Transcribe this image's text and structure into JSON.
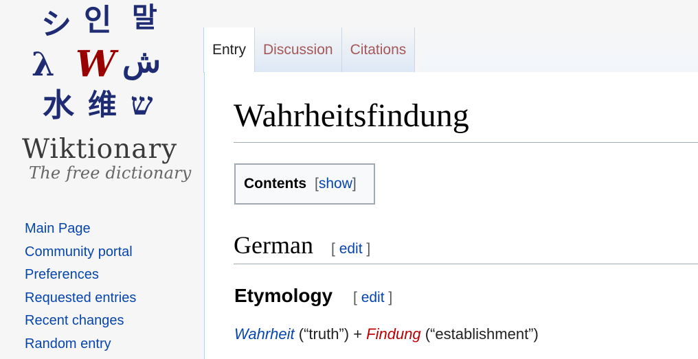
{
  "logo": {
    "glyphs": [
      "シ",
      "인",
      "말",
      "λ",
      "W",
      "ش",
      "水",
      "维",
      "ש"
    ],
    "wordmark": "Wiktionary",
    "tagline": "The free dictionary"
  },
  "sidebar": {
    "items": [
      {
        "label": "Main Page"
      },
      {
        "label": "Community portal"
      },
      {
        "label": "Preferences"
      },
      {
        "label": "Requested entries"
      },
      {
        "label": "Recent changes"
      },
      {
        "label": "Random entry"
      }
    ]
  },
  "tabs": [
    {
      "label": "Entry",
      "selected": true
    },
    {
      "label": "Discussion",
      "selected": false
    },
    {
      "label": "Citations",
      "selected": false
    }
  ],
  "page": {
    "title": "Wahrheitsfindung",
    "toc": {
      "title": "Contents",
      "toggle": "show",
      "open": "[",
      "close": "]"
    },
    "language_heading": "German",
    "etymology_heading": "Etymology",
    "edit": {
      "open": "[",
      "label": "edit",
      "close": "]"
    },
    "etymology": {
      "term1": "Wahrheit",
      "gloss1": " (“truth”) + ",
      "term2": "Findung",
      "gloss2": " (“establishment”)"
    }
  },
  "colors": {
    "link": "#0645ad",
    "redlink": "#ba0000",
    "visited_tab": "#a55858",
    "logo_glyph": "#1f2c74",
    "logo_w": "#990000"
  }
}
